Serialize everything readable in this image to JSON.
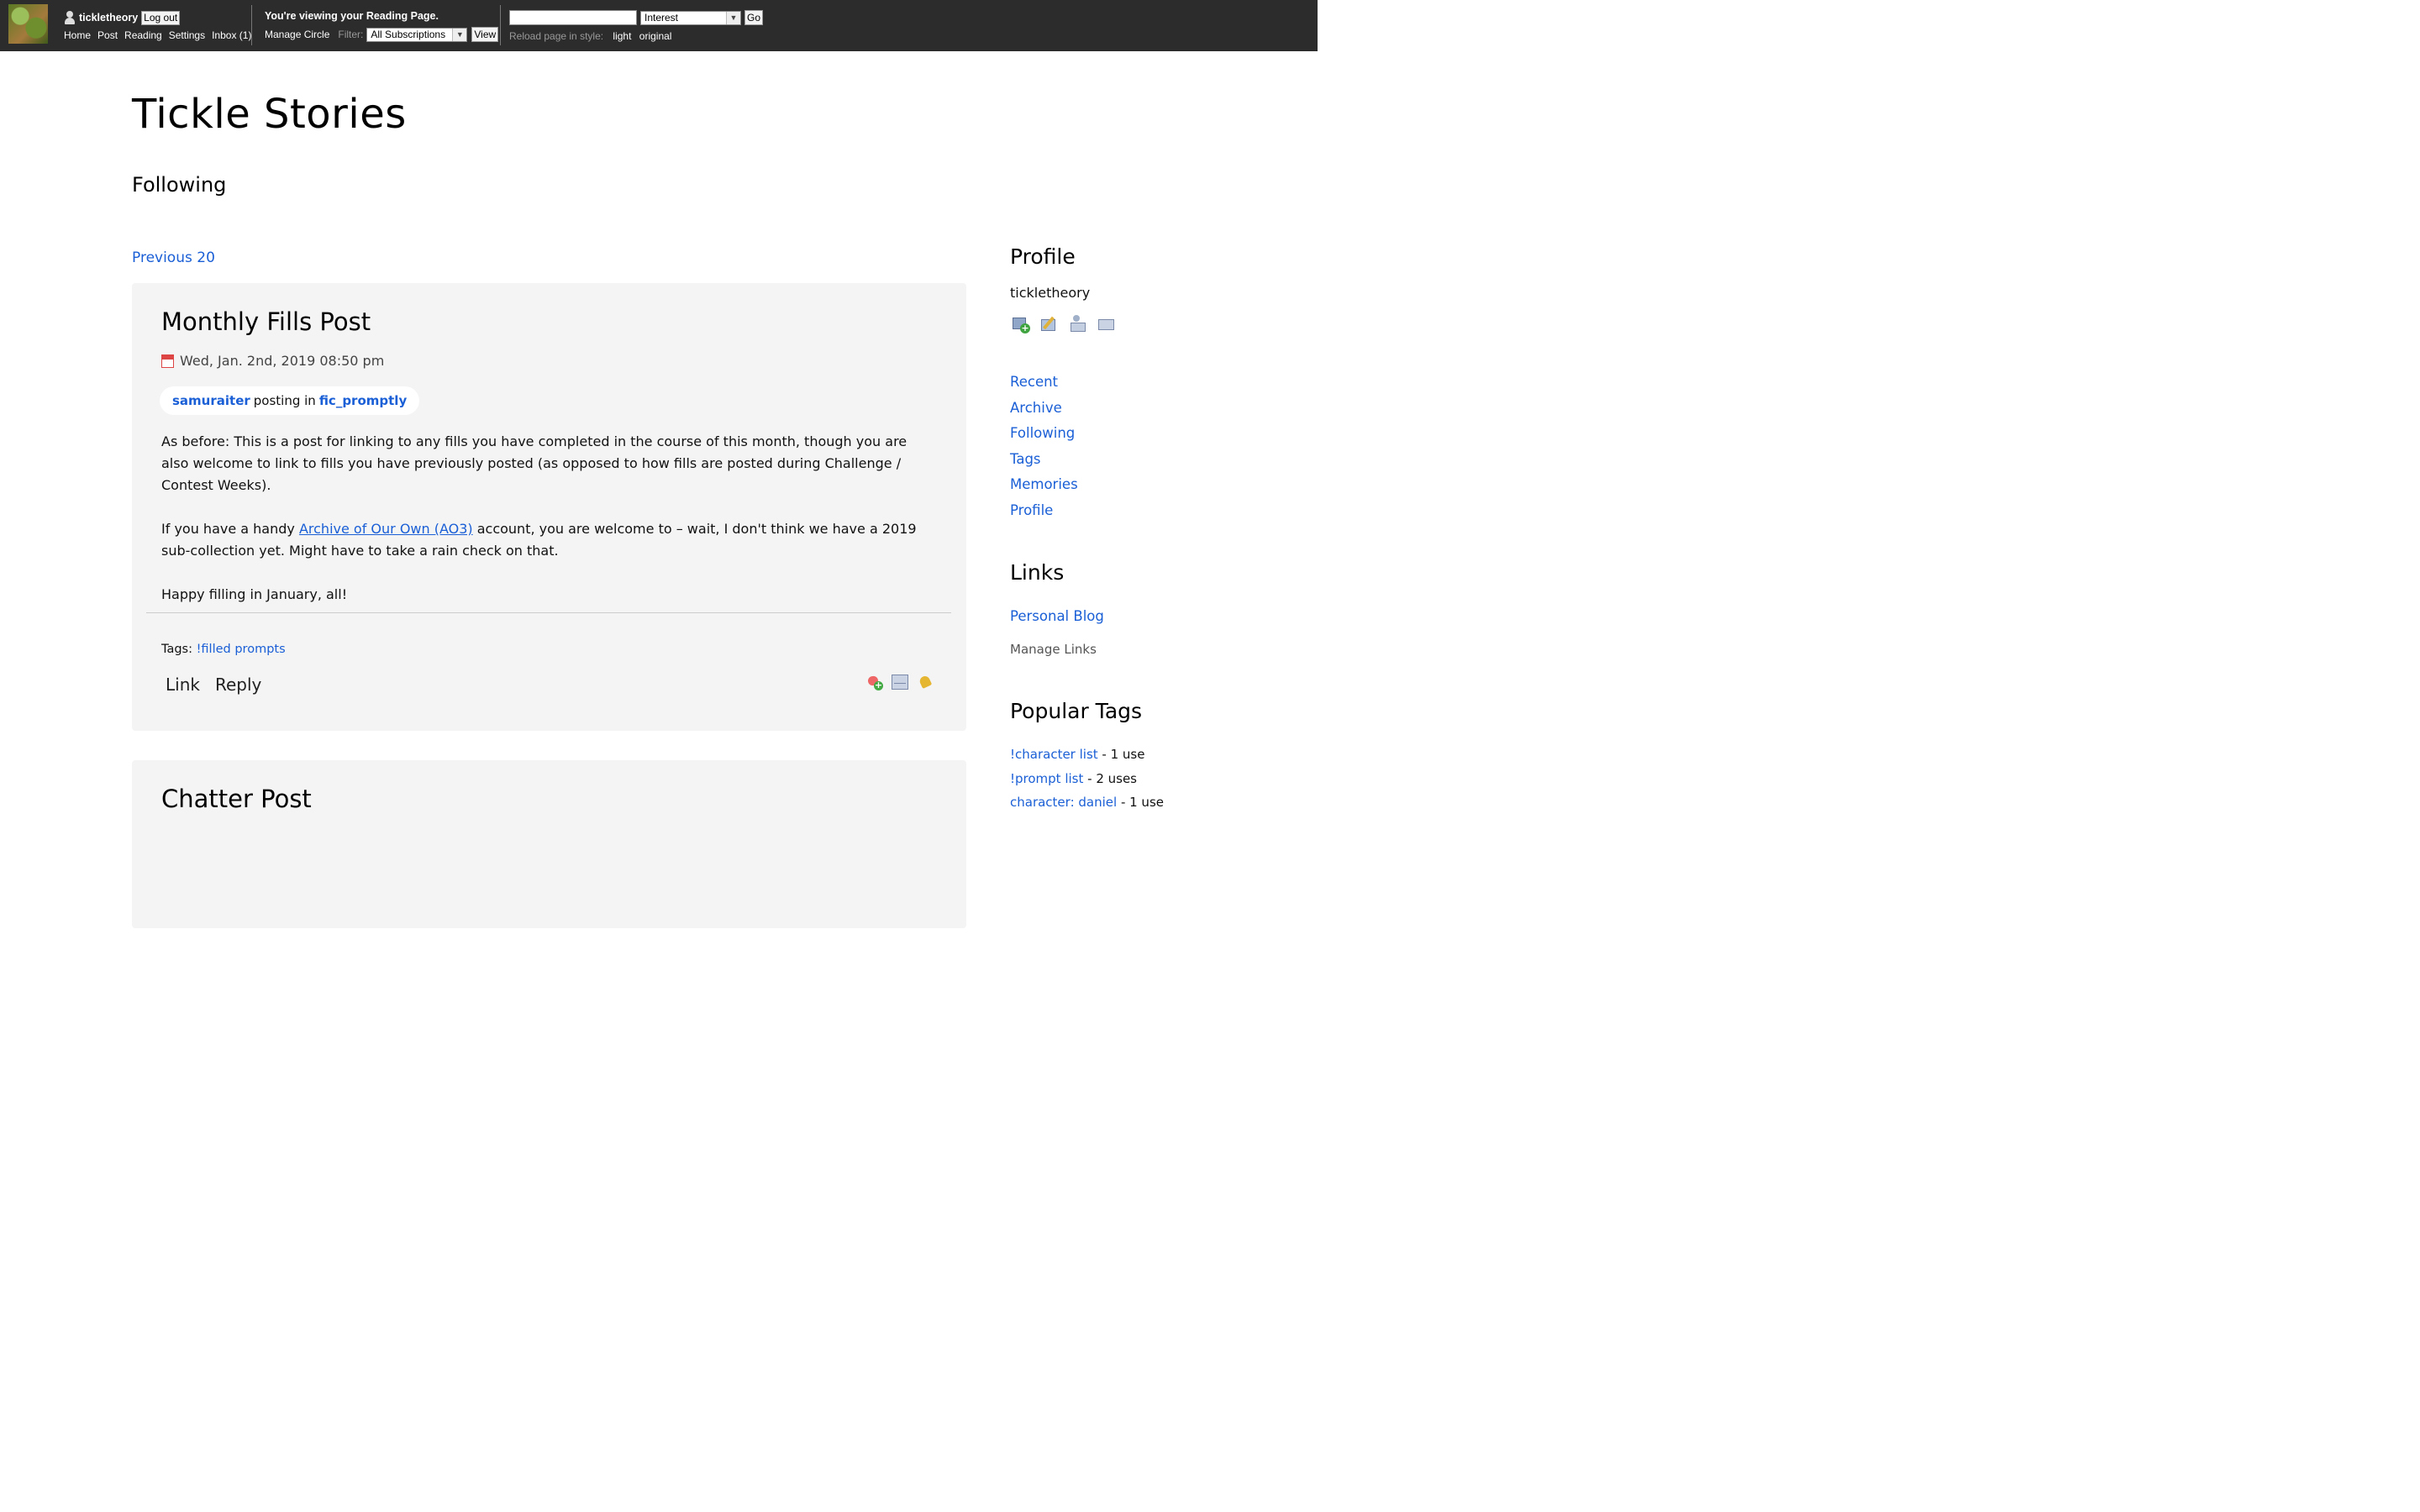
{
  "topbar": {
    "username": "tickletheory",
    "logout_label": "Log out",
    "nav": [
      "Home",
      "Post",
      "Reading",
      "Settings",
      "Inbox (1)"
    ],
    "reading_message": "You're viewing your Reading Page.",
    "manage_circle": "Manage Circle",
    "filter_label": "Filter:",
    "filter_value": "All Subscriptions",
    "view_label": "View",
    "search_value": "",
    "search_type": "Interest",
    "go_label": "Go",
    "reload_label": "Reload page in style:",
    "style_light": "light",
    "style_original": "original"
  },
  "page": {
    "title": "Tickle Stories",
    "subtitle": "Following",
    "previous_link": "Previous 20"
  },
  "entries": [
    {
      "title": "Monthly Fills Post",
      "date": "Wed, Jan. 2nd, 2019 08:50 pm",
      "poster": "samuraiter",
      "posting_in": "posting in",
      "community": "fic_promptly",
      "para1": "As before: This is a post for linking to any fills you have completed in the course of this month, though you are also welcome to link to fills you have previously posted (as opposed to how fills are posted during Challenge / Contest Weeks).",
      "para2_before": "If you have a handy ",
      "para2_link": "Archive of Our Own (AO3)",
      "para2_after": " account, you are welcome to – wait, I don't think we have a 2019 sub-collection yet. Might have to take a rain check on that.",
      "para3": "Happy filling in January, all!",
      "tags_label": "Tags:",
      "tag": "!filled prompts",
      "link_label": "Link",
      "reply_label": "Reply"
    },
    {
      "title": "Chatter Post"
    }
  ],
  "sidebar": {
    "profile_heading": "Profile",
    "profile_name": "tickletheory",
    "nav": [
      "Recent",
      "Archive",
      "Following",
      "Tags",
      "Memories",
      "Profile"
    ],
    "links_heading": "Links",
    "personal_blog": "Personal Blog",
    "manage_links": "Manage Links",
    "tags_heading": "Popular Tags",
    "tags": [
      {
        "name": "!character list",
        "count": " - 1 use"
      },
      {
        "name": "!prompt list",
        "count": " - 2 uses"
      },
      {
        "name": "character: daniel",
        "count": " - 1 use"
      }
    ]
  },
  "colors": {
    "topbar": "#2c2c2c",
    "link": "#1a5fd6",
    "entry_bg": "#f4f4f4"
  }
}
